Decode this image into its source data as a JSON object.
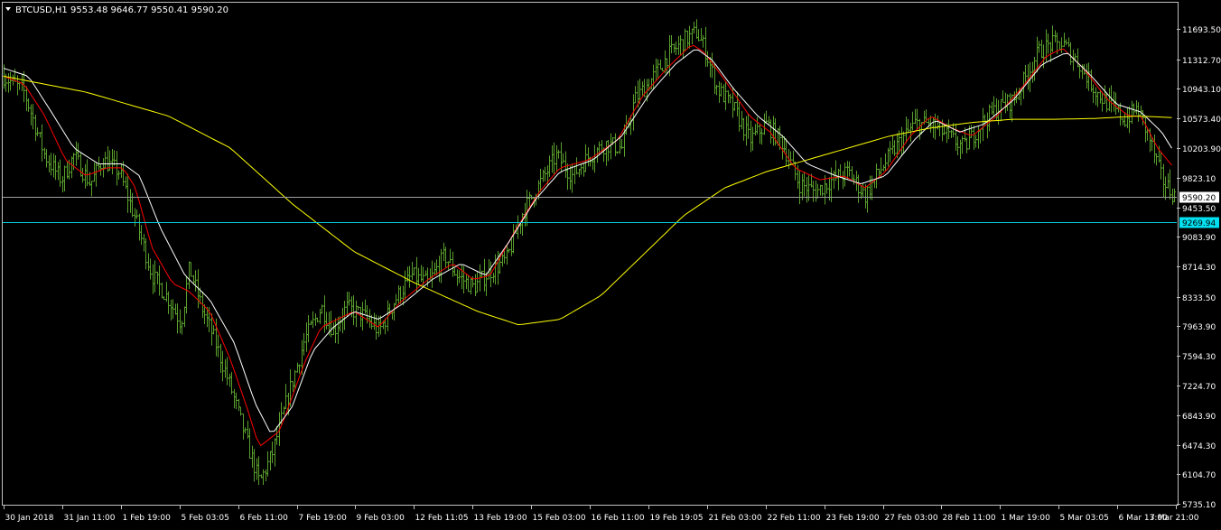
{
  "header": {
    "symbol_label": "BTCUSD,H1",
    "ohlc": "9553.48 9646.77 9550.41 9590.20"
  },
  "colors": {
    "background": "#000000",
    "bars": "#5aa02c",
    "ma_fast": "#ff0000",
    "ma_mid": "#ffffff",
    "ma_slow": "#ffff00",
    "axis": "#c0c0c0",
    "bid_line": "#a0a0a0",
    "level_line": "#00c8d8",
    "level_tag": "#00e0f0"
  },
  "chart_data": {
    "type": "line",
    "title": "BTCUSD,H1",
    "ylim": [
      5600,
      11860
    ],
    "y_ticks": [
      "11693.50",
      "11312.70",
      "10943.10",
      "10573.40",
      "10203.90",
      "9823.10",
      "9453.50",
      "9083.90",
      "8714.30",
      "8333.50",
      "7963.90",
      "7594.30",
      "7224.70",
      "6843.90",
      "6474.30",
      "6104.70",
      "5735.10"
    ],
    "x_ticks": [
      "30 Jan 2018",
      "31 Jan 11:00",
      "1 Feb 19:00",
      "5 Feb 03:05",
      "6 Feb 11:00",
      "7 Feb 19:00",
      "9 Feb 03:00",
      "12 Feb 11:05",
      "13 Feb 19:00",
      "15 Feb 03:00",
      "16 Feb 11:00",
      "19 Feb 19:05",
      "21 Feb 03:00",
      "22 Feb 11:00",
      "23 Feb 19:00",
      "27 Feb 03:00",
      "28 Feb 11:00",
      "1 Mar 19:00",
      "5 Mar 03:05",
      "6 Mar 13:00",
      "7 Mar 21:00"
    ],
    "bar_count": 520,
    "price_path": [
      [
        0,
        11100
      ],
      [
        10,
        10900
      ],
      [
        20,
        10100
      ],
      [
        28,
        9800
      ],
      [
        34,
        10100
      ],
      [
        42,
        9750
      ],
      [
        48,
        10050
      ],
      [
        56,
        9900
      ],
      [
        64,
        9300
      ],
      [
        72,
        8600
      ],
      [
        80,
        8300
      ],
      [
        86,
        8000
      ],
      [
        90,
        8700
      ],
      [
        96,
        8200
      ],
      [
        102,
        7800
      ],
      [
        110,
        7200
      ],
      [
        118,
        6500
      ],
      [
        124,
        6000
      ],
      [
        130,
        6350
      ],
      [
        138,
        7100
      ],
      [
        146,
        7800
      ],
      [
        154,
        8200
      ],
      [
        160,
        7900
      ],
      [
        166,
        8200
      ],
      [
        174,
        8100
      ],
      [
        182,
        7900
      ],
      [
        190,
        8300
      ],
      [
        198,
        8600
      ],
      [
        206,
        8500
      ],
      [
        214,
        8850
      ],
      [
        220,
        8600
      ],
      [
        228,
        8450
      ],
      [
        236,
        8650
      ],
      [
        244,
        8800
      ],
      [
        252,
        9400
      ],
      [
        260,
        9750
      ],
      [
        268,
        10100
      ],
      [
        276,
        9850
      ],
      [
        284,
        10100
      ],
      [
        292,
        10250
      ],
      [
        300,
        10200
      ],
      [
        306,
        10800
      ],
      [
        314,
        11050
      ],
      [
        322,
        11350
      ],
      [
        330,
        11550
      ],
      [
        336,
        11650
      ],
      [
        340,
        11450
      ],
      [
        346,
        10950
      ],
      [
        354,
        10700
      ],
      [
        362,
        10300
      ],
      [
        370,
        10500
      ],
      [
        378,
        10250
      ],
      [
        386,
        9750
      ],
      [
        394,
        9650
      ],
      [
        402,
        9800
      ],
      [
        410,
        9900
      ],
      [
        418,
        9600
      ],
      [
        426,
        9950
      ],
      [
        434,
        10250
      ],
      [
        442,
        10500
      ],
      [
        450,
        10500
      ],
      [
        458,
        10350
      ],
      [
        466,
        10200
      ],
      [
        474,
        10500
      ],
      [
        482,
        10700
      ],
      [
        490,
        10800
      ],
      [
        496,
        11100
      ],
      [
        502,
        11400
      ],
      [
        508,
        11500
      ],
      [
        514,
        11500
      ],
      [
        522,
        11250
      ],
      [
        530,
        10900
      ],
      [
        538,
        10700
      ],
      [
        544,
        10550
      ],
      [
        550,
        10700
      ],
      [
        556,
        10300
      ],
      [
        562,
        9800
      ],
      [
        568,
        9600
      ]
    ],
    "series": [
      {
        "name": "",
        "points": [
          [
            0,
            11100
          ],
          [
            10,
            11000
          ],
          [
            20,
            10600
          ],
          [
            30,
            10050
          ],
          [
            40,
            9850
          ],
          [
            50,
            9950
          ],
          [
            58,
            9950
          ],
          [
            64,
            9700
          ],
          [
            72,
            8950
          ],
          [
            82,
            8500
          ],
          [
            90,
            8400
          ],
          [
            100,
            8150
          ],
          [
            110,
            7550
          ],
          [
            118,
            6950
          ],
          [
            124,
            6450
          ],
          [
            134,
            6650
          ],
          [
            146,
            7500
          ],
          [
            154,
            7950
          ],
          [
            162,
            8050
          ],
          [
            170,
            8150
          ],
          [
            182,
            7950
          ],
          [
            192,
            8250
          ],
          [
            206,
            8550
          ],
          [
            218,
            8750
          ],
          [
            228,
            8550
          ],
          [
            236,
            8600
          ],
          [
            248,
            9150
          ],
          [
            260,
            9650
          ],
          [
            270,
            9950
          ],
          [
            284,
            10050
          ],
          [
            298,
            10300
          ],
          [
            310,
            10850
          ],
          [
            322,
            11200
          ],
          [
            334,
            11500
          ],
          [
            340,
            11400
          ],
          [
            350,
            11050
          ],
          [
            362,
            10600
          ],
          [
            372,
            10400
          ],
          [
            384,
            9950
          ],
          [
            396,
            9800
          ],
          [
            408,
            9850
          ],
          [
            418,
            9700
          ],
          [
            428,
            9900
          ],
          [
            440,
            10350
          ],
          [
            450,
            10600
          ],
          [
            460,
            10450
          ],
          [
            470,
            10350
          ],
          [
            482,
            10600
          ],
          [
            494,
            10950
          ],
          [
            506,
            11350
          ],
          [
            514,
            11450
          ],
          [
            524,
            11200
          ],
          [
            536,
            10800
          ],
          [
            546,
            10600
          ],
          [
            552,
            10600
          ],
          [
            560,
            10200
          ],
          [
            568,
            9950
          ]
        ]
      },
      {
        "name": "",
        "points": [
          [
            0,
            11200
          ],
          [
            12,
            11100
          ],
          [
            22,
            10700
          ],
          [
            34,
            10200
          ],
          [
            46,
            10000
          ],
          [
            58,
            10000
          ],
          [
            66,
            9850
          ],
          [
            76,
            9200
          ],
          [
            88,
            8600
          ],
          [
            100,
            8300
          ],
          [
            112,
            7750
          ],
          [
            122,
            7000
          ],
          [
            130,
            6600
          ],
          [
            140,
            6950
          ],
          [
            150,
            7650
          ],
          [
            160,
            7950
          ],
          [
            170,
            8150
          ],
          [
            182,
            8050
          ],
          [
            194,
            8250
          ],
          [
            208,
            8550
          ],
          [
            222,
            8750
          ],
          [
            234,
            8600
          ],
          [
            246,
            9050
          ],
          [
            258,
            9550
          ],
          [
            270,
            9900
          ],
          [
            286,
            10050
          ],
          [
            300,
            10350
          ],
          [
            314,
            10900
          ],
          [
            326,
            11250
          ],
          [
            336,
            11450
          ],
          [
            344,
            11300
          ],
          [
            354,
            10950
          ],
          [
            366,
            10600
          ],
          [
            378,
            10350
          ],
          [
            390,
            10000
          ],
          [
            404,
            9850
          ],
          [
            416,
            9750
          ],
          [
            428,
            9850
          ],
          [
            442,
            10300
          ],
          [
            452,
            10550
          ],
          [
            464,
            10400
          ],
          [
            476,
            10500
          ],
          [
            490,
            10800
          ],
          [
            504,
            11250
          ],
          [
            516,
            11400
          ],
          [
            528,
            11100
          ],
          [
            540,
            10750
          ],
          [
            552,
            10650
          ],
          [
            562,
            10400
          ],
          [
            568,
            10150
          ]
        ]
      },
      {
        "name": "",
        "points": [
          [
            0,
            11100
          ],
          [
            40,
            10900
          ],
          [
            80,
            10600
          ],
          [
            110,
            10200
          ],
          [
            140,
            9500
          ],
          [
            170,
            8900
          ],
          [
            200,
            8500
          ],
          [
            230,
            8150
          ],
          [
            250,
            7980
          ],
          [
            270,
            8050
          ],
          [
            290,
            8350
          ],
          [
            310,
            8850
          ],
          [
            330,
            9350
          ],
          [
            350,
            9700
          ],
          [
            370,
            9900
          ],
          [
            390,
            10050
          ],
          [
            410,
            10200
          ],
          [
            430,
            10350
          ],
          [
            450,
            10450
          ],
          [
            470,
            10520
          ],
          [
            490,
            10560
          ],
          [
            510,
            10560
          ],
          [
            530,
            10570
          ],
          [
            550,
            10600
          ],
          [
            568,
            10580
          ]
        ]
      }
    ],
    "bid_price": "9590.20",
    "level_price": "9269.94"
  }
}
